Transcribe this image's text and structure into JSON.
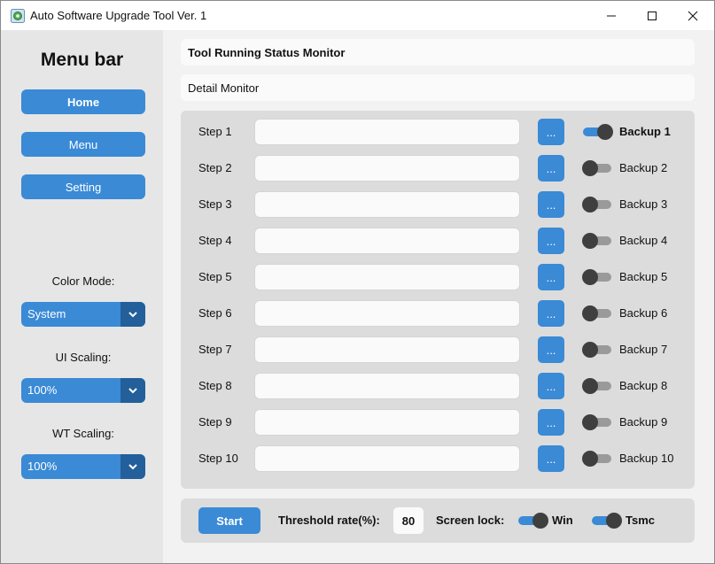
{
  "window": {
    "title": "Auto Software Upgrade Tool Ver. 1",
    "controls": {
      "minimize_icon": "minimize-icon",
      "maximize_icon": "maximize-icon",
      "close_icon": "close-icon"
    }
  },
  "sidebar": {
    "title": "Menu bar",
    "buttons": [
      {
        "label": "Home",
        "active": true
      },
      {
        "label": "Menu",
        "active": false
      },
      {
        "label": "Setting",
        "active": false
      }
    ],
    "color_mode": {
      "label": "Color Mode:",
      "value": "System"
    },
    "ui_scaling": {
      "label": "UI Scaling:",
      "value": "100%"
    },
    "wt_scaling": {
      "label": "WT Scaling:",
      "value": "100%"
    }
  },
  "main": {
    "status_title": "Tool Running Status Monitor",
    "detail_title": "Detail Monitor",
    "browse_label": "...",
    "steps": [
      {
        "label": "Step 1",
        "value": "",
        "backup_label": "Backup 1",
        "backup_on": true
      },
      {
        "label": "Step 2",
        "value": "",
        "backup_label": "Backup 2",
        "backup_on": false
      },
      {
        "label": "Step 3",
        "value": "",
        "backup_label": "Backup 3",
        "backup_on": false
      },
      {
        "label": "Step 4",
        "value": "",
        "backup_label": "Backup 4",
        "backup_on": false
      },
      {
        "label": "Step 5",
        "value": "",
        "backup_label": "Backup 5",
        "backup_on": false
      },
      {
        "label": "Step 6",
        "value": "",
        "backup_label": "Backup 6",
        "backup_on": false
      },
      {
        "label": "Step 7",
        "value": "",
        "backup_label": "Backup 7",
        "backup_on": false
      },
      {
        "label": "Step 8",
        "value": "",
        "backup_label": "Backup 8",
        "backup_on": false
      },
      {
        "label": "Step 9",
        "value": "",
        "backup_label": "Backup 9",
        "backup_on": false
      },
      {
        "label": "Step 10",
        "value": "",
        "backup_label": "Backup 10",
        "backup_on": false
      }
    ]
  },
  "bottom": {
    "start_label": "Start",
    "threshold_label": "Threshold rate(%):",
    "threshold_value": "80",
    "screen_lock_label": "Screen lock:",
    "win_label": "Win",
    "win_on": true,
    "tsmc_label": "Tsmc",
    "tsmc_on": true
  },
  "colors": {
    "accent": "#3a8ad6",
    "accent_dark": "#235f9a",
    "sidebar_bg": "#e6e6e6",
    "panel_bg": "#dcdcdc",
    "toggle_off_track": "#9a9a9a",
    "knob": "#3f3f3f"
  }
}
